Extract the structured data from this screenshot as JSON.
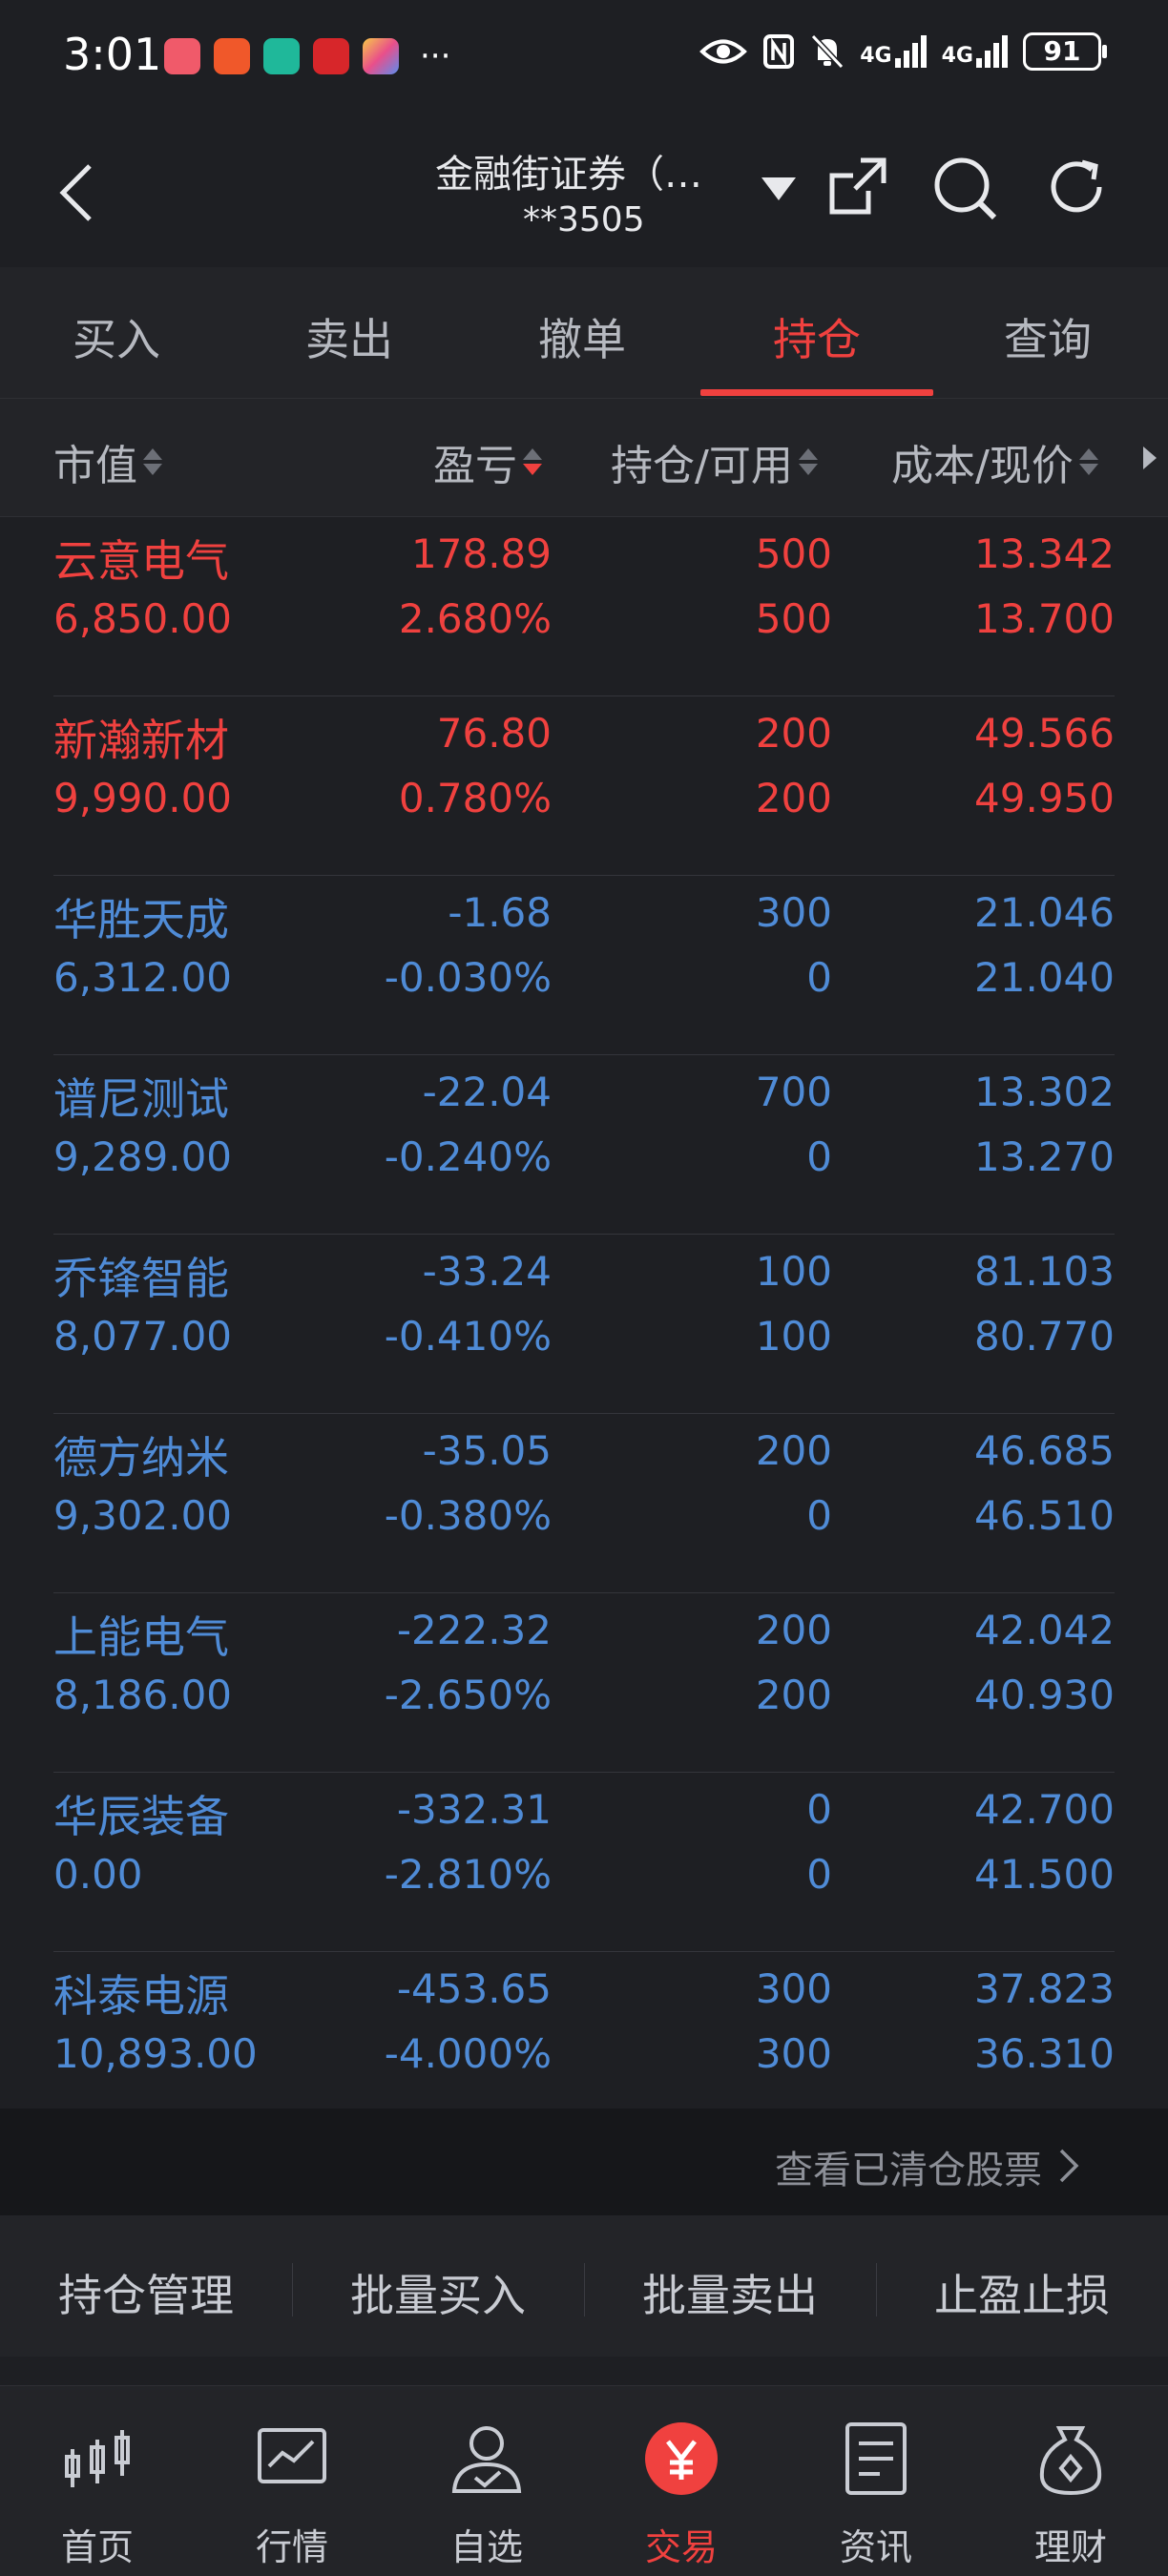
{
  "status_bar": {
    "time": "3:01",
    "network1": "4G",
    "network2": "4G",
    "battery": "91"
  },
  "header": {
    "broker": "金融街证券（…",
    "account": "**3505"
  },
  "tabs": [
    {
      "label": "买入"
    },
    {
      "label": "卖出"
    },
    {
      "label": "撤单"
    },
    {
      "label": "持仓"
    },
    {
      "label": "查询"
    }
  ],
  "columns": {
    "market_value": "市值",
    "profit_loss": "盈亏",
    "position": "持仓/可用",
    "cost_price": "成本/现价"
  },
  "positions": [
    {
      "name": "云意电气",
      "market_value": "6,850.00",
      "pl": "178.89",
      "pl_pct": "2.680%",
      "position": "500",
      "available": "500",
      "cost": "13.342",
      "price": "13.700",
      "trend": "up"
    },
    {
      "name": "新瀚新材",
      "market_value": "9,990.00",
      "pl": "76.80",
      "pl_pct": "0.780%",
      "position": "200",
      "available": "200",
      "cost": "49.566",
      "price": "49.950",
      "trend": "up"
    },
    {
      "name": "华胜天成",
      "market_value": "6,312.00",
      "pl": "-1.68",
      "pl_pct": "-0.030%",
      "position": "300",
      "available": "0",
      "cost": "21.046",
      "price": "21.040",
      "trend": "down"
    },
    {
      "name": "谱尼测试",
      "market_value": "9,289.00",
      "pl": "-22.04",
      "pl_pct": "-0.240%",
      "position": "700",
      "available": "0",
      "cost": "13.302",
      "price": "13.270",
      "trend": "down"
    },
    {
      "name": "乔锋智能",
      "market_value": "8,077.00",
      "pl": "-33.24",
      "pl_pct": "-0.410%",
      "position": "100",
      "available": "100",
      "cost": "81.103",
      "price": "80.770",
      "trend": "down"
    },
    {
      "name": "德方纳米",
      "market_value": "9,302.00",
      "pl": "-35.05",
      "pl_pct": "-0.380%",
      "position": "200",
      "available": "0",
      "cost": "46.685",
      "price": "46.510",
      "trend": "down"
    },
    {
      "name": "上能电气",
      "market_value": "8,186.00",
      "pl": "-222.32",
      "pl_pct": "-2.650%",
      "position": "200",
      "available": "200",
      "cost": "42.042",
      "price": "40.930",
      "trend": "down"
    },
    {
      "name": "华辰装备",
      "market_value": "0.00",
      "pl": "-332.31",
      "pl_pct": "-2.810%",
      "position": "0",
      "available": "0",
      "cost": "42.700",
      "price": "41.500",
      "trend": "down"
    },
    {
      "name": "科泰电源",
      "market_value": "10,893.00",
      "pl": "-453.65",
      "pl_pct": "-4.000%",
      "position": "300",
      "available": "300",
      "cost": "37.823",
      "price": "36.310",
      "trend": "down"
    }
  ],
  "cleared_link": "查看已清仓股票",
  "actions": [
    {
      "label": "持仓管理"
    },
    {
      "label": "批量买入"
    },
    {
      "label": "批量卖出"
    },
    {
      "label": "止盈止损"
    }
  ],
  "bottom_nav": [
    {
      "label": "首页",
      "icon": "candlestick-icon"
    },
    {
      "label": "行情",
      "icon": "chart-icon"
    },
    {
      "label": "自选",
      "icon": "user-check-icon"
    },
    {
      "label": "交易",
      "icon": "yen-icon"
    },
    {
      "label": "资讯",
      "icon": "document-icon"
    },
    {
      "label": "理财",
      "icon": "money-bag-icon"
    }
  ],
  "colors": {
    "up": "#f0413f",
    "down": "#4f8bd6",
    "accent": "#f0413f"
  }
}
